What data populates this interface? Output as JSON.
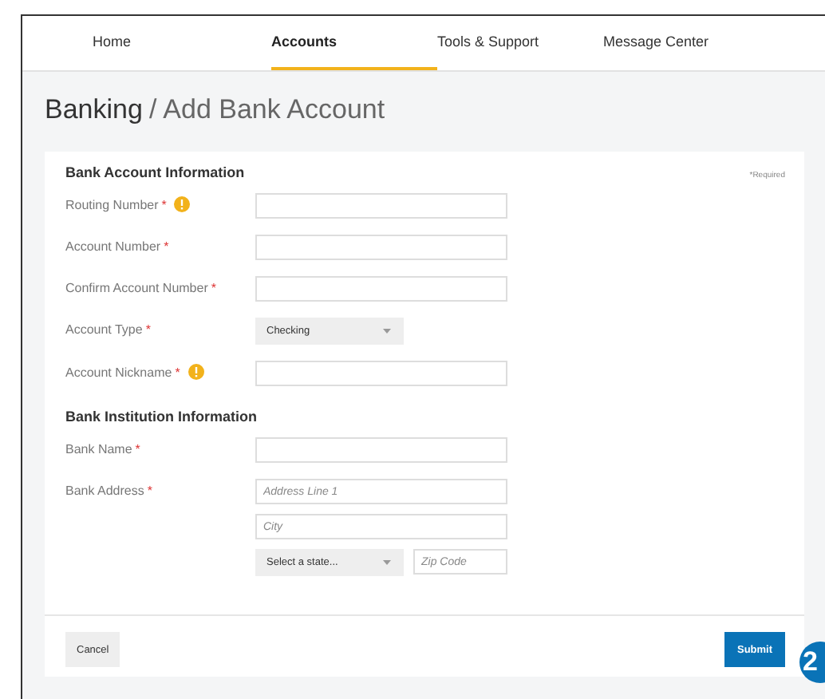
{
  "tabs": [
    {
      "label": "Home",
      "selected": false
    },
    {
      "label": "Accounts",
      "selected": true
    },
    {
      "label": "Tools & Support",
      "selected": false
    },
    {
      "label": "Message Center",
      "selected": false
    }
  ],
  "breadcrumb": {
    "section": "Banking",
    "separator": "/",
    "page": "Add Bank Account"
  },
  "sections": [
    {
      "title": "Bank Account Information",
      "note": "*Required",
      "fields": [
        {
          "label": "Routing Number",
          "required": "*",
          "info": true,
          "inputs": [
            {
              "kind": "text"
            }
          ]
        },
        {
          "label": "Account Number",
          "required": "*",
          "info": false,
          "inputs": [
            {
              "kind": "text"
            }
          ]
        },
        {
          "label": "Confirm Account Number",
          "required": "*",
          "info": false,
          "inputs": [
            {
              "kind": "text"
            }
          ]
        },
        {
          "label": "Account Type",
          "required": "*",
          "info": false,
          "inputs": [
            {
              "kind": "select",
              "value": "Checking"
            }
          ]
        },
        {
          "label": "Account Nickname",
          "required": "*",
          "info": true,
          "inputs": [
            {
              "kind": "text"
            }
          ]
        }
      ]
    },
    {
      "title": "Bank Institution Information",
      "fields": [
        {
          "label": "Bank Name",
          "required": "*",
          "info": false,
          "inputs": [
            {
              "kind": "text"
            }
          ]
        },
        {
          "label": "Bank Address",
          "required": "*",
          "info": false,
          "inputs": [
            {
              "kind": "text",
              "placeholder": "Address Line 1"
            },
            {
              "kind": "text",
              "placeholder": "City"
            },
            {
              "kind": "select",
              "value": "Select a state...",
              "with": {
                "kind": "short",
                "placeholder": "Zip Code"
              }
            }
          ]
        }
      ]
    }
  ],
  "buttons": [
    {
      "label": "Cancel",
      "kind": "secondary"
    },
    {
      "label": "Submit",
      "kind": "primary"
    }
  ],
  "callout": {
    "label": "2"
  }
}
